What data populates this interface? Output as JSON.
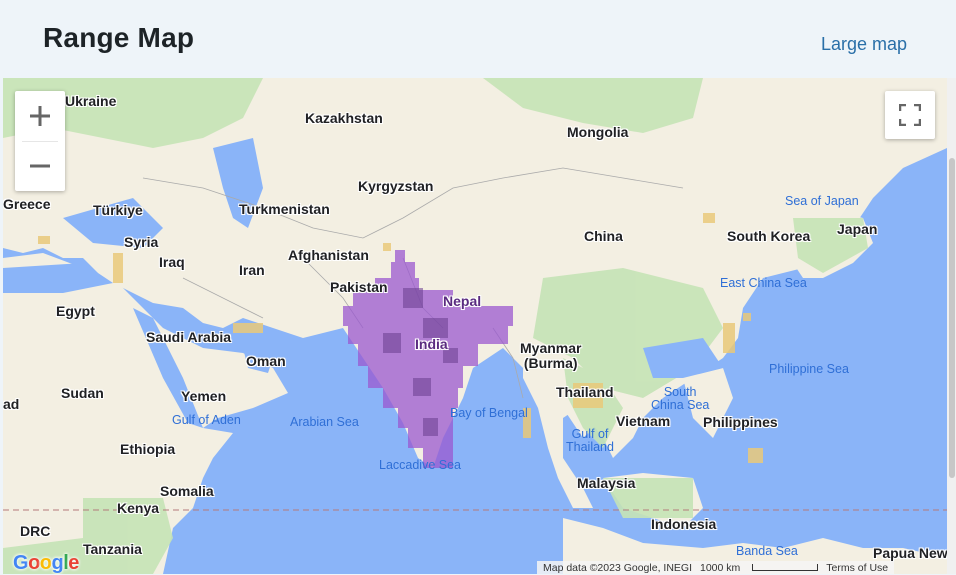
{
  "header": {
    "title": "Range Map",
    "large_map_link": "Large map"
  },
  "map": {
    "controls": {
      "zoom_in": "+",
      "zoom_out": "−"
    },
    "countries": {
      "ukraine": "Ukraine",
      "kazakhstan": "Kazakhstan",
      "mongolia": "Mongolia",
      "greece": "Greece",
      "turkiye": "Türkiye",
      "kyrgyzstan": "Kyrgyzstan",
      "turkmenistan": "Turkmenistan",
      "china": "China",
      "south_korea": "South Korea",
      "japan": "Japan",
      "syria": "Syria",
      "iraq": "Iraq",
      "iran": "Iran",
      "afghanistan": "Afghanistan",
      "pakistan": "Pakistan",
      "nepal": "Nepal",
      "egypt": "Egypt",
      "saudi_arabia": "Saudi Arabia",
      "oman": "Oman",
      "india": "India",
      "myanmar": "Myanmar\n(Burma)",
      "sudan": "Sudan",
      "yemen": "Yemen",
      "chad": "ad",
      "thailand": "Thailand",
      "vietnam": "Vietnam",
      "philippines": "Philippines",
      "ethiopia": "Ethiopia",
      "somalia": "Somalia",
      "malaysia": "Malaysia",
      "kenya": "Kenya",
      "drc": "DRC",
      "indonesia": "Indonesia",
      "tanzania": "Tanzania",
      "papua": "Papua New"
    },
    "seas": {
      "sea_of_japan": "Sea of Japan",
      "east_china_sea": "East China Sea",
      "philippine_sea": "Philippine Sea",
      "south_china_sea": "South\nChina Sea",
      "gulf_of_aden": "Gulf of Aden",
      "arabian_sea": "Arabian Sea",
      "bay_of_bengal": "Bay of Bengal",
      "gulf_of_thailand": "Gulf of\nThailand",
      "laccadive_sea": "Laccadive Sea",
      "banda_sea": "Banda Sea"
    },
    "footer": {
      "map_data": "Map data ©2023 Google, INEGI",
      "scale": "1000 km",
      "terms": "Terms of Use"
    },
    "logo": "Google",
    "range_color": "#9b59d0",
    "water_color": "#8ab4f8",
    "land_color": "#f4f1e6",
    "green_color": "#b7dcab"
  }
}
